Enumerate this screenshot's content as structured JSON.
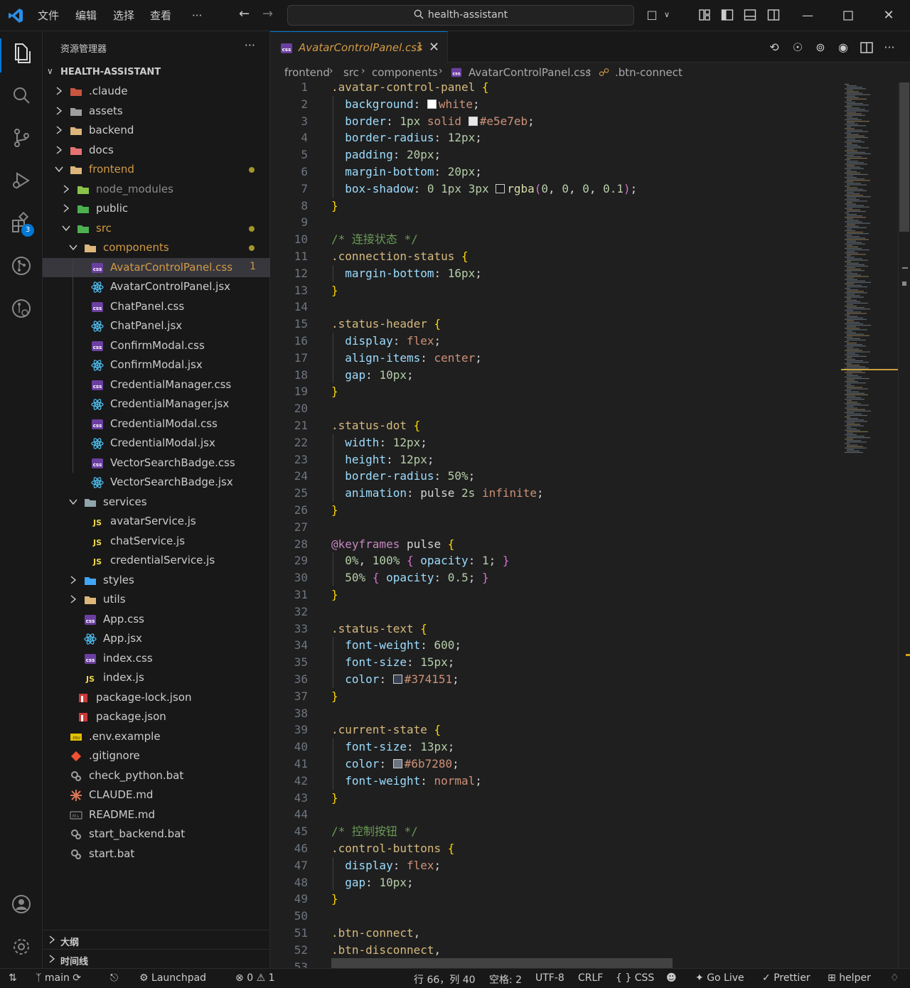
{
  "titlebar": {
    "menus": [
      "文件",
      "编辑",
      "选择",
      "查看",
      "···"
    ],
    "search": "health-assistant"
  },
  "sidebar": {
    "title": "资源管理器",
    "more": "···",
    "root": "HEALTH-ASSISTANT",
    "tree": [
      {
        "label": ".claude",
        "depth": 0,
        "kind": "folder",
        "open": false,
        "icon": "claude-folder-icon",
        "color": "#cccccc"
      },
      {
        "label": "assets",
        "depth": 0,
        "kind": "folder",
        "open": false,
        "icon": "assets-folder-icon",
        "color": "#cccccc"
      },
      {
        "label": "backend",
        "depth": 0,
        "kind": "folder",
        "open": false,
        "icon": "folder-icon",
        "color": "#cccccc"
      },
      {
        "label": "docs",
        "depth": 0,
        "kind": "folder",
        "open": false,
        "icon": "docs-folder-icon",
        "color": "#cccccc"
      },
      {
        "label": "frontend",
        "depth": 0,
        "kind": "folder",
        "open": true,
        "icon": "folder-open-icon",
        "color": "#d19a46",
        "dot": true
      },
      {
        "label": "node_modules",
        "depth": 1,
        "kind": "folder",
        "open": false,
        "icon": "node-modules-folder-icon",
        "color": "#8b8b8b"
      },
      {
        "label": "public",
        "depth": 1,
        "kind": "folder",
        "open": false,
        "icon": "public-folder-icon",
        "color": "#cccccc"
      },
      {
        "label": "src",
        "depth": 1,
        "kind": "folder",
        "open": true,
        "icon": "src-folder-icon",
        "color": "#d19a46",
        "dot": true
      },
      {
        "label": "components",
        "depth": 2,
        "kind": "folder",
        "open": true,
        "icon": "components-folder-icon",
        "color": "#d19a46",
        "dot": true
      },
      {
        "label": "AvatarControlPanel.css",
        "depth": 3,
        "kind": "file",
        "icon": "css-file-icon",
        "color": "#d19a46",
        "num": "1",
        "selected": true
      },
      {
        "label": "AvatarControlPanel.jsx",
        "depth": 3,
        "kind": "file",
        "icon": "react-file-icon",
        "color": "#cccccc"
      },
      {
        "label": "ChatPanel.css",
        "depth": 3,
        "kind": "file",
        "icon": "css-file-icon",
        "color": "#cccccc"
      },
      {
        "label": "ChatPanel.jsx",
        "depth": 3,
        "kind": "file",
        "icon": "react-file-icon",
        "color": "#cccccc"
      },
      {
        "label": "ConfirmModal.css",
        "depth": 3,
        "kind": "file",
        "icon": "css-file-icon",
        "color": "#cccccc"
      },
      {
        "label": "ConfirmModal.jsx",
        "depth": 3,
        "kind": "file",
        "icon": "react-file-icon",
        "color": "#cccccc"
      },
      {
        "label": "CredentialManager.css",
        "depth": 3,
        "kind": "file",
        "icon": "css-file-icon",
        "color": "#cccccc"
      },
      {
        "label": "CredentialManager.jsx",
        "depth": 3,
        "kind": "file",
        "icon": "react-file-icon",
        "color": "#cccccc"
      },
      {
        "label": "CredentialModal.css",
        "depth": 3,
        "kind": "file",
        "icon": "css-file-icon",
        "color": "#cccccc"
      },
      {
        "label": "CredentialModal.jsx",
        "depth": 3,
        "kind": "file",
        "icon": "react-file-icon",
        "color": "#cccccc"
      },
      {
        "label": "VectorSearchBadge.css",
        "depth": 3,
        "kind": "file",
        "icon": "css-file-icon",
        "color": "#cccccc"
      },
      {
        "label": "VectorSearchBadge.jsx",
        "depth": 3,
        "kind": "file",
        "icon": "react-file-icon",
        "color": "#cccccc"
      },
      {
        "label": "services",
        "depth": 2,
        "kind": "folder",
        "open": true,
        "icon": "services-folder-icon",
        "color": "#cccccc"
      },
      {
        "label": "avatarService.js",
        "depth": 3,
        "kind": "file",
        "icon": "js-file-icon",
        "color": "#cccccc"
      },
      {
        "label": "chatService.js",
        "depth": 3,
        "kind": "file",
        "icon": "js-file-icon",
        "color": "#cccccc"
      },
      {
        "label": "credentialService.js",
        "depth": 3,
        "kind": "file",
        "icon": "js-file-icon",
        "color": "#cccccc"
      },
      {
        "label": "styles",
        "depth": 2,
        "kind": "folder",
        "open": false,
        "icon": "styles-folder-icon",
        "color": "#cccccc"
      },
      {
        "label": "utils",
        "depth": 2,
        "kind": "folder",
        "open": false,
        "icon": "utils-folder-icon",
        "color": "#cccccc"
      },
      {
        "label": "App.css",
        "depth": 2,
        "kind": "file",
        "icon": "css-file-icon",
        "color": "#cccccc"
      },
      {
        "label": "App.jsx",
        "depth": 2,
        "kind": "file",
        "icon": "react-file-icon",
        "color": "#cccccc"
      },
      {
        "label": "index.css",
        "depth": 2,
        "kind": "file",
        "icon": "css-file-icon",
        "color": "#cccccc"
      },
      {
        "label": "index.js",
        "depth": 2,
        "kind": "file",
        "icon": "js-file-icon",
        "color": "#cccccc"
      },
      {
        "label": "package-lock.json",
        "depth": 1,
        "kind": "file",
        "icon": "npm-file-icon",
        "color": "#cccccc"
      },
      {
        "label": "package.json",
        "depth": 1,
        "kind": "file",
        "icon": "npm-file-icon",
        "color": "#cccccc"
      },
      {
        "label": ".env.example",
        "depth": 0,
        "kind": "file",
        "icon": "env-file-icon",
        "color": "#cccccc"
      },
      {
        "label": ".gitignore",
        "depth": 0,
        "kind": "file",
        "icon": "git-file-icon",
        "color": "#cccccc"
      },
      {
        "label": "check_python.bat",
        "depth": 0,
        "kind": "file",
        "icon": "bat-file-icon",
        "color": "#cccccc"
      },
      {
        "label": "CLAUDE.md",
        "depth": 0,
        "kind": "file",
        "icon": "claude-file-icon",
        "color": "#cccccc"
      },
      {
        "label": "README.md",
        "depth": 0,
        "kind": "file",
        "icon": "markdown-file-icon",
        "color": "#cccccc"
      },
      {
        "label": "start_backend.bat",
        "depth": 0,
        "kind": "file",
        "icon": "bat-file-icon",
        "color": "#cccccc"
      },
      {
        "label": "start.bat",
        "depth": 0,
        "kind": "file",
        "icon": "bat-file-icon",
        "color": "#cccccc"
      }
    ],
    "outline": "大纲",
    "timeline": "时间线"
  },
  "activity": {
    "extensions_badge": "3"
  },
  "tab": {
    "label": "AvatarControlPanel.css",
    "problems": "1"
  },
  "breadcrumb": [
    "frontend",
    "src",
    "components",
    "AvatarControlPanel.css",
    ".btn-connect"
  ],
  "code": [
    [
      [
        "sel",
        ".avatar-control-panel "
      ],
      [
        "br",
        "{"
      ]
    ],
    [
      [
        "ind",
        "  "
      ],
      [
        "prop",
        "background"
      ],
      [
        "pun",
        ": "
      ],
      [
        "sw",
        "#ffffff"
      ],
      [
        "val",
        "white"
      ],
      [
        "pun",
        ";"
      ]
    ],
    [
      [
        "ind",
        "  "
      ],
      [
        "prop",
        "border"
      ],
      [
        "pun",
        ": "
      ],
      [
        "num",
        "1px"
      ],
      [
        "pun",
        " "
      ],
      [
        "val",
        "solid"
      ],
      [
        "pun",
        " "
      ],
      [
        "sw",
        "#e5e7eb"
      ],
      [
        "val",
        "#e5e7eb"
      ],
      [
        "pun",
        ";"
      ]
    ],
    [
      [
        "ind",
        "  "
      ],
      [
        "prop",
        "border-radius"
      ],
      [
        "pun",
        ": "
      ],
      [
        "num",
        "12px"
      ],
      [
        "pun",
        ";"
      ]
    ],
    [
      [
        "ind",
        "  "
      ],
      [
        "prop",
        "padding"
      ],
      [
        "pun",
        ": "
      ],
      [
        "num",
        "20px"
      ],
      [
        "pun",
        ";"
      ]
    ],
    [
      [
        "ind",
        "  "
      ],
      [
        "prop",
        "margin-bottom"
      ],
      [
        "pun",
        ": "
      ],
      [
        "num",
        "20px"
      ],
      [
        "pun",
        ";"
      ]
    ],
    [
      [
        "ind",
        "  "
      ],
      [
        "prop",
        "box-shadow"
      ],
      [
        "pun",
        ": "
      ],
      [
        "num",
        "0"
      ],
      [
        "pun",
        " "
      ],
      [
        "num",
        "1px"
      ],
      [
        "pun",
        " "
      ],
      [
        "num",
        "3px"
      ],
      [
        "pun",
        " "
      ],
      [
        "sw",
        "#1a1a1a"
      ],
      [
        "fn",
        "rgba"
      ],
      [
        "br2",
        "("
      ],
      [
        "num",
        "0"
      ],
      [
        "pun",
        ", "
      ],
      [
        "num",
        "0"
      ],
      [
        "pun",
        ", "
      ],
      [
        "num",
        "0"
      ],
      [
        "pun",
        ", "
      ],
      [
        "num",
        "0.1"
      ],
      [
        "br2",
        ")"
      ],
      [
        "pun",
        ";"
      ]
    ],
    [
      [
        "br",
        "}"
      ]
    ],
    [],
    [
      [
        "cmt",
        "/* 连接状态 */"
      ]
    ],
    [
      [
        "sel",
        ".connection-status "
      ],
      [
        "br",
        "{"
      ]
    ],
    [
      [
        "ind",
        "  "
      ],
      [
        "prop",
        "margin-bottom"
      ],
      [
        "pun",
        ": "
      ],
      [
        "num",
        "16px"
      ],
      [
        "pun",
        ";"
      ]
    ],
    [
      [
        "br",
        "}"
      ]
    ],
    [],
    [
      [
        "sel",
        ".status-header "
      ],
      [
        "br",
        "{"
      ]
    ],
    [
      [
        "ind",
        "  "
      ],
      [
        "prop",
        "display"
      ],
      [
        "pun",
        ": "
      ],
      [
        "val",
        "flex"
      ],
      [
        "pun",
        ";"
      ]
    ],
    [
      [
        "ind",
        "  "
      ],
      [
        "prop",
        "align-items"
      ],
      [
        "pun",
        ": "
      ],
      [
        "val",
        "center"
      ],
      [
        "pun",
        ";"
      ]
    ],
    [
      [
        "ind",
        "  "
      ],
      [
        "prop",
        "gap"
      ],
      [
        "pun",
        ": "
      ],
      [
        "num",
        "10px"
      ],
      [
        "pun",
        ";"
      ]
    ],
    [
      [
        "br",
        "}"
      ]
    ],
    [],
    [
      [
        "sel",
        ".status-dot "
      ],
      [
        "br",
        "{"
      ]
    ],
    [
      [
        "ind",
        "  "
      ],
      [
        "prop",
        "width"
      ],
      [
        "pun",
        ": "
      ],
      [
        "num",
        "12px"
      ],
      [
        "pun",
        ";"
      ]
    ],
    [
      [
        "ind",
        "  "
      ],
      [
        "prop",
        "height"
      ],
      [
        "pun",
        ": "
      ],
      [
        "num",
        "12px"
      ],
      [
        "pun",
        ";"
      ]
    ],
    [
      [
        "ind",
        "  "
      ],
      [
        "prop",
        "border-radius"
      ],
      [
        "pun",
        ": "
      ],
      [
        "num",
        "50%"
      ],
      [
        "pun",
        ";"
      ]
    ],
    [
      [
        "ind",
        "  "
      ],
      [
        "prop",
        "animation"
      ],
      [
        "pun",
        ": pulse "
      ],
      [
        "num",
        "2s"
      ],
      [
        "pun",
        " "
      ],
      [
        "val",
        "infinite"
      ],
      [
        "pun",
        ";"
      ]
    ],
    [
      [
        "br",
        "}"
      ]
    ],
    [],
    [
      [
        "at",
        "@keyframes"
      ],
      [
        "pun",
        " pulse "
      ],
      [
        "br",
        "{"
      ]
    ],
    [
      [
        "ind",
        "  "
      ],
      [
        "num",
        "0%"
      ],
      [
        "pun",
        ", "
      ],
      [
        "num",
        "100%"
      ],
      [
        "pun",
        " "
      ],
      [
        "br2",
        "{"
      ],
      [
        "pun",
        " "
      ],
      [
        "prop",
        "opacity"
      ],
      [
        "pun",
        ": "
      ],
      [
        "num",
        "1"
      ],
      [
        "pun",
        "; "
      ],
      [
        "br2",
        "}"
      ]
    ],
    [
      [
        "ind",
        "  "
      ],
      [
        "num",
        "50%"
      ],
      [
        "pun",
        " "
      ],
      [
        "br2",
        "{"
      ],
      [
        "pun",
        " "
      ],
      [
        "prop",
        "opacity"
      ],
      [
        "pun",
        ": "
      ],
      [
        "num",
        "0.5"
      ],
      [
        "pun",
        "; "
      ],
      [
        "br2",
        "}"
      ]
    ],
    [
      [
        "br",
        "}"
      ]
    ],
    [],
    [
      [
        "sel",
        ".status-text "
      ],
      [
        "br",
        "{"
      ]
    ],
    [
      [
        "ind",
        "  "
      ],
      [
        "prop",
        "font-weight"
      ],
      [
        "pun",
        ": "
      ],
      [
        "num",
        "600"
      ],
      [
        "pun",
        ";"
      ]
    ],
    [
      [
        "ind",
        "  "
      ],
      [
        "prop",
        "font-size"
      ],
      [
        "pun",
        ": "
      ],
      [
        "num",
        "15px"
      ],
      [
        "pun",
        ";"
      ]
    ],
    [
      [
        "ind",
        "  "
      ],
      [
        "prop",
        "color"
      ],
      [
        "pun",
        ": "
      ],
      [
        "sw",
        "#374151"
      ],
      [
        "val",
        "#374151"
      ],
      [
        "pun",
        ";"
      ]
    ],
    [
      [
        "br",
        "}"
      ]
    ],
    [],
    [
      [
        "sel",
        ".current-state "
      ],
      [
        "br",
        "{"
      ]
    ],
    [
      [
        "ind",
        "  "
      ],
      [
        "prop",
        "font-size"
      ],
      [
        "pun",
        ": "
      ],
      [
        "num",
        "13px"
      ],
      [
        "pun",
        ";"
      ]
    ],
    [
      [
        "ind",
        "  "
      ],
      [
        "prop",
        "color"
      ],
      [
        "pun",
        ": "
      ],
      [
        "sw",
        "#6b7280"
      ],
      [
        "val",
        "#6b7280"
      ],
      [
        "pun",
        ";"
      ]
    ],
    [
      [
        "ind",
        "  "
      ],
      [
        "prop",
        "font-weight"
      ],
      [
        "pun",
        ": "
      ],
      [
        "val",
        "normal"
      ],
      [
        "pun",
        ";"
      ]
    ],
    [
      [
        "br",
        "}"
      ]
    ],
    [],
    [
      [
        "cmt",
        "/* 控制按钮 */"
      ]
    ],
    [
      [
        "sel",
        ".control-buttons "
      ],
      [
        "br",
        "{"
      ]
    ],
    [
      [
        "ind",
        "  "
      ],
      [
        "prop",
        "display"
      ],
      [
        "pun",
        ": "
      ],
      [
        "val",
        "flex"
      ],
      [
        "pun",
        ";"
      ]
    ],
    [
      [
        "ind",
        "  "
      ],
      [
        "prop",
        "gap"
      ],
      [
        "pun",
        ": "
      ],
      [
        "num",
        "10px"
      ],
      [
        "pun",
        ";"
      ]
    ],
    [
      [
        "br",
        "}"
      ]
    ],
    [],
    [
      [
        "sel",
        ".btn-connect"
      ],
      [
        "pun",
        ","
      ]
    ],
    [
      [
        "sel",
        ".btn-disconnect"
      ],
      [
        "pun",
        ","
      ]
    ],
    [
      [
        "sel",
        ".btn-reconnect "
      ],
      [
        "br",
        "{"
      ]
    ]
  ],
  "status": {
    "branch": "main",
    "launchpad": "Launchpad",
    "errors": "0",
    "warnings": "1",
    "position": "行 66，列 40",
    "spaces": "空格: 2",
    "encoding": "UTF-8",
    "eol": "CRLF",
    "language": "CSS",
    "golive": "Go Live",
    "prettier": "Prettier",
    "helper": "helper"
  }
}
